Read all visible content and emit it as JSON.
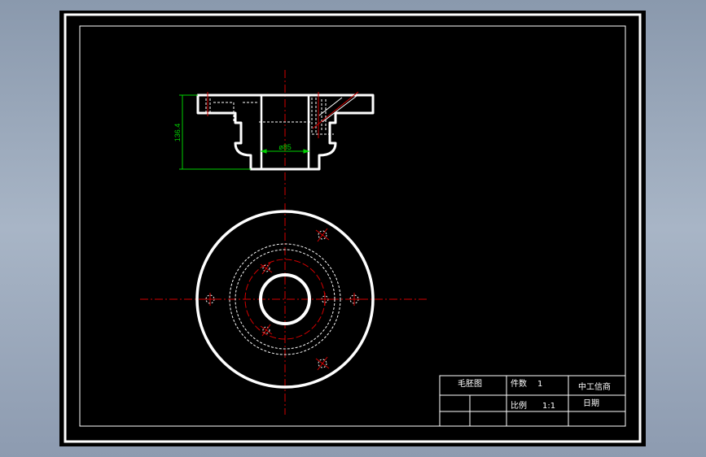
{
  "drawing": {
    "dimension_height": "136.4",
    "dimension_diameter": "ø85"
  },
  "title_block": {
    "name": "毛胚图",
    "quantity_label": "件数",
    "quantity_value": "1",
    "company": "中工信商",
    "scale_label": "比例",
    "scale_value": "1:1",
    "date_label": "日期"
  },
  "colors": {
    "background": "#000000",
    "outline": "#ffffff",
    "centerline": "#d40000",
    "dimension": "#00d000"
  }
}
